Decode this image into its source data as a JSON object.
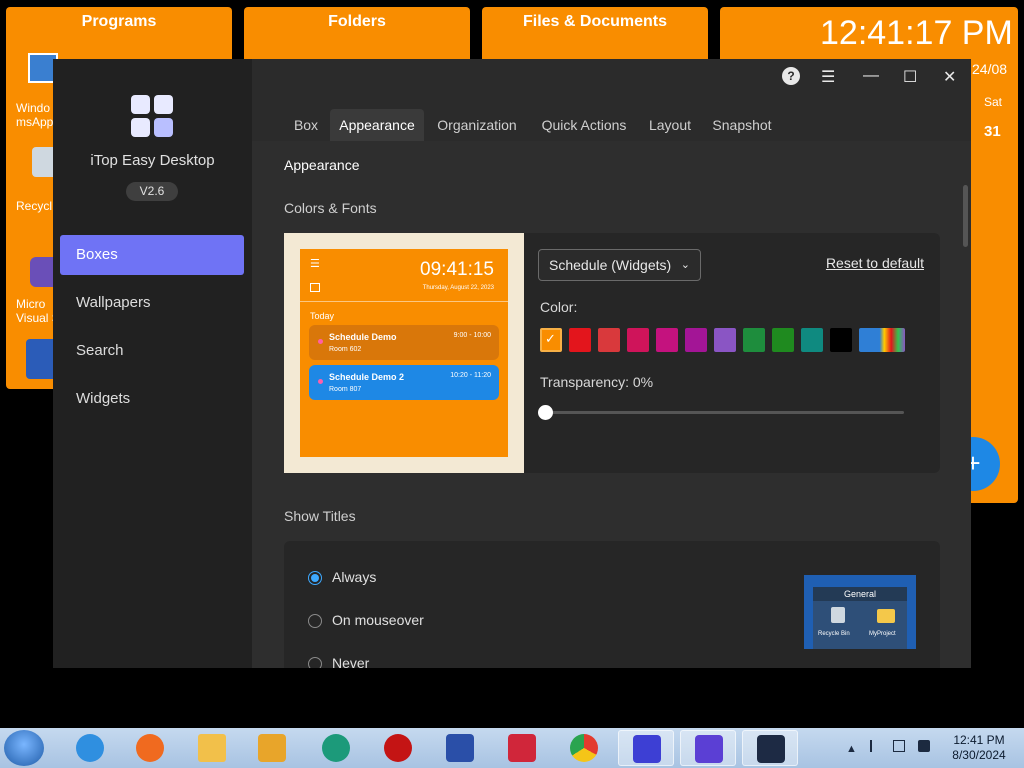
{
  "desktop": {
    "fences": [
      {
        "title": "Programs"
      },
      {
        "title": "Folders"
      },
      {
        "title": "Files & Documents"
      }
    ],
    "program_labels": [
      "Windo",
      "msApp",
      "Recycl",
      "Micro",
      "Visual S"
    ],
    "clock": {
      "time": "12:41:17 PM",
      "date_partial": "24/08",
      "day": "Sat",
      "day_num": "31",
      "add_symbol": "+"
    }
  },
  "window": {
    "app_name": "iTop Easy Desktop",
    "version": "V2.6",
    "controls": {
      "help": "?",
      "menu": "☰",
      "minimize": "—",
      "maximize": "☐",
      "close": "✕"
    },
    "nav": [
      {
        "label": "Boxes"
      },
      {
        "label": "Wallpapers"
      },
      {
        "label": "Search"
      },
      {
        "label": "Widgets"
      }
    ],
    "tabs": [
      {
        "label": "Box"
      },
      {
        "label": "Appearance"
      },
      {
        "label": "Organization"
      },
      {
        "label": "Quick Actions"
      },
      {
        "label": "Layout"
      },
      {
        "label": "Snapshot"
      }
    ],
    "content": {
      "heading": "Appearance",
      "colors_fonts": {
        "title": "Colors & Fonts",
        "preview": {
          "time": "09:41:15",
          "date": "Thursday, August 22, 2023",
          "today": "Today",
          "events": [
            {
              "title": "Schedule Demo",
              "room": "Room 602",
              "time": "9:00 - 10:00"
            },
            {
              "title": "Schedule Demo 2",
              "room": "Room 807",
              "time": "10:20 - 11:20"
            }
          ]
        },
        "dropdown_value": "Schedule (Widgets)",
        "reset_label": "Reset to default",
        "color_label": "Color:",
        "swatches": [
          "#f98d00",
          "#e3151c",
          "#d9393c",
          "#cf145a",
          "#c4127e",
          "#a31596",
          "#8a55c4",
          "#1e8d3d",
          "#1f8a1f",
          "#0f8a80",
          "#000000",
          "#2f7fd6"
        ],
        "transparency_label": "Transparency: 0%",
        "transparency": 0
      },
      "show_titles": {
        "title": "Show Titles",
        "options": [
          {
            "label": "Always",
            "selected": true
          },
          {
            "label": "On mouseover",
            "selected": false
          },
          {
            "label": "Never",
            "selected": false
          }
        ],
        "mini_preview": {
          "title": "General",
          "items": [
            "Recycle Bin",
            "MyProject"
          ]
        }
      }
    }
  },
  "taskbar": {
    "time": "12:41 PM",
    "date": "8/30/2024",
    "tray_arrow": "▲"
  }
}
